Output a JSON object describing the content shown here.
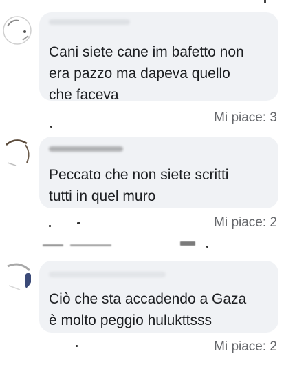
{
  "comments": [
    {
      "text": "Cani siete cane im bafetto non\nera pazzo ma dapeva quello\nche faceva",
      "likes": "Mi piace: 3",
      "avatar_icon": "avatar-icon"
    },
    {
      "text": "Peccato che non siete scritti\ntutti in quel muro",
      "likes": "Mi piace: 2",
      "avatar_icon": "avatar-icon"
    },
    {
      "text": "Ciò che sta accadendo a Gaza\nè molto peggio hulukttsss",
      "likes": "Mi piace: 2",
      "avatar_icon": "avatar-icon"
    }
  ]
}
